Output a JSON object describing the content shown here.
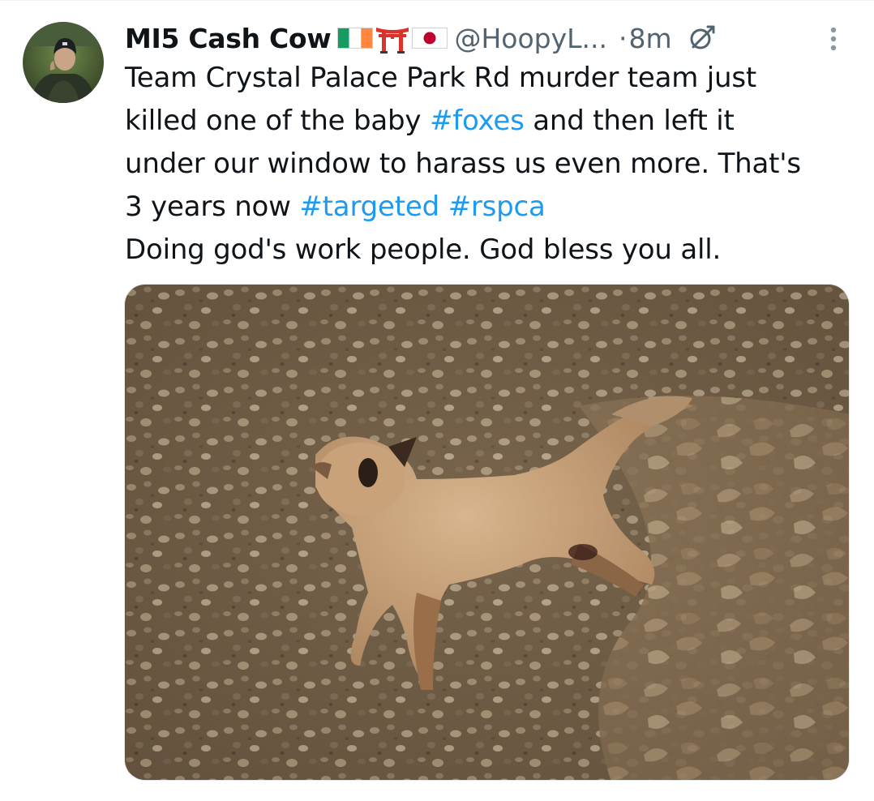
{
  "tweet": {
    "author": {
      "display_name": "MI5 Cash Cow",
      "flag_emojis": [
        "ireland-flag-icon",
        "torii-gate-icon",
        "japan-flag-icon"
      ],
      "handle": "@HoopyL...",
      "avatar": "avatar-photo"
    },
    "separator": "·",
    "timestamp": "8m",
    "edited_icon": "edited-icon",
    "more_icon": "more-vertical-icon",
    "text_lines": [
      [
        "Team Crystal Palace Park Rd murder team just"
      ],
      [
        "killed one of the baby ",
        "#foxes",
        " and then left it"
      ],
      [
        "under our window to harass us even more. That's"
      ],
      [
        "3 years now ",
        "#targeted",
        " ",
        "#rspca"
      ],
      [
        "Doing god's work people. God bless you all."
      ]
    ],
    "hashtags": [
      "#foxes",
      "#targeted",
      "#rspca"
    ],
    "media": {
      "kind": "photo",
      "description_icon": "photo-image"
    }
  },
  "colors": {
    "text": "#0f1419",
    "secondary": "#536471",
    "link": "#1d9bf0"
  }
}
